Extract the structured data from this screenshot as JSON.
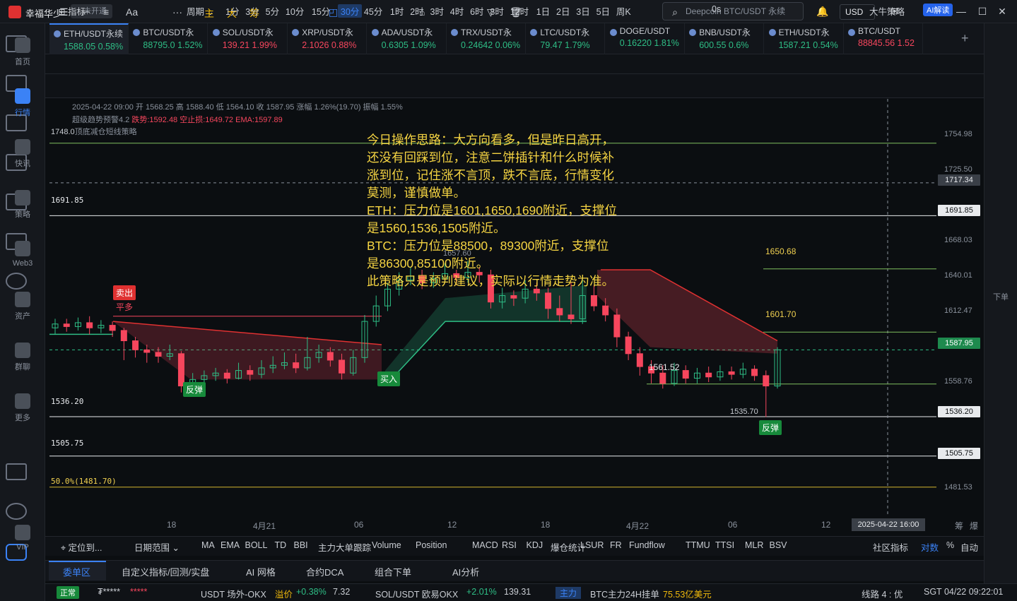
{
  "app": {
    "user": "幸福华少",
    "status": "未开通",
    "search_placeholder": "Deepcoin BTC/USDT 永续",
    "currency": "USD"
  },
  "sidebar": [
    {
      "label": "首页",
      "icon": "home-icon"
    },
    {
      "label": "行情",
      "icon": "chart-icon",
      "active": true
    },
    {
      "label": "快讯",
      "icon": "news-icon"
    },
    {
      "label": "策略",
      "icon": "robot-icon"
    },
    {
      "label": "Web3",
      "icon": "web3-icon"
    },
    {
      "label": "资产",
      "icon": "wallet-icon"
    },
    {
      "label": "群聊",
      "icon": "chat-icon"
    },
    {
      "label": "更多",
      "icon": "grid-icon"
    },
    {
      "label": "VIP",
      "icon": "vip-icon"
    }
  ],
  "right_sidebar": {
    "order_label": "下单"
  },
  "tabs": [
    {
      "name": "ETH/USDT永续",
      "price": "1588.05",
      "change": "0.58%",
      "dir": "up",
      "active": true
    },
    {
      "name": "BTC/USDT永",
      "price": "88795.0",
      "change": "1.52%",
      "dir": "up"
    },
    {
      "name": "SOL/USDT永",
      "price": "139.21",
      "change": "1.99%",
      "dir": "dn"
    },
    {
      "name": "XRP/USDT永",
      "price": "2.1026",
      "change": "0.88%",
      "dir": "dn"
    },
    {
      "name": "ADA/USDT永",
      "price": "0.6305",
      "change": "1.09%",
      "dir": "up"
    },
    {
      "name": "TRX/USDT永",
      "price": "0.24642",
      "change": "0.06%",
      "dir": "up"
    },
    {
      "name": "LTC/USDT永",
      "price": "79.47",
      "change": "1.79%",
      "dir": "up"
    },
    {
      "name": "DOGE/USDT",
      "price": "0.16220",
      "change": "1.81%",
      "dir": "up"
    },
    {
      "name": "BNB/USDT永",
      "price": "600.55",
      "change": "0.6%",
      "dir": "up"
    },
    {
      "name": "ETH/USDT永",
      "price": "1587.21",
      "change": "0.54%",
      "dir": "up"
    },
    {
      "name": "BTC/USDT",
      "price": "88845.56",
      "change": "1.52",
      "dir": "dn"
    }
  ],
  "periods": {
    "indicator": "指标",
    "cycle": "周期",
    "items": [
      "1分",
      "3分",
      "5分",
      "10分",
      "15分",
      "30分",
      "45分",
      "1时",
      "2时",
      "3时",
      "4时",
      "6时",
      "8时",
      "12时",
      "1日",
      "2日",
      "3日",
      "5日",
      "周K"
    ],
    "active": "30分",
    "countdown": "0s",
    "strategy": "大牛策略",
    "ai": "AI解读"
  },
  "draw_tools": [
    "主",
    "大",
    "筹"
  ],
  "info": {
    "line1": "2025-04-22 09:00  开 1568.25  高 1588.40  低 1564.10  收 1587.95  涨幅 1.26%(19.70)  振幅 1.55%",
    "line2a": "超级趋势预警4.2",
    "line2b": "跌势:1592.48  空止损:1649.72  EMA:1597.89",
    "line3a": "1748.0",
    "line3b": "顶底减仓短线策略"
  },
  "levels": {
    "l1": "1691.85",
    "l2": "1536.20",
    "l3": "1505.75",
    "l4": "50.0%(1481.70)"
  },
  "annotations": {
    "a1": "1650.68",
    "a2": "1601.70",
    "a3": "1561.52",
    "a4": "1535.70",
    "a5": "1657.60"
  },
  "signals": {
    "sell": "卖出",
    "close_long": "平多",
    "rebound1": "反弹",
    "buy": "买入",
    "rebound2": "反弹"
  },
  "note": "今日操作思路：大方向看多，但是昨日高开，\n还没有回踩到位，注意二饼插针和什么时候补\n涨到位，记住涨不言顶，跌不言底，行情变化\n莫测，谨慎做单。\nETH：压力位是1601,1650,1690附近，支撑位\n是1560,1536,1505附近。\nBTC：压力位是88500，89300附近，支撑位\n是86300,85100附近。\n此策略只是预判建议，实际以行情走势为准。",
  "price_axis": {
    "ticks": [
      "1754.98",
      "1725.50",
      "1668.03",
      "1640.01",
      "1612.47",
      "1558.76",
      "1481.53"
    ],
    "crosshair": "1717.34",
    "tags": [
      "1691.85",
      "1587.95",
      "1536.20",
      "1505.75"
    ]
  },
  "time_axis": {
    "labels": [
      "18",
      "4月21",
      "06",
      "12",
      "18",
      "4月22",
      "06",
      "12"
    ],
    "crosshair": "2025-04-22 16:00",
    "right": [
      "筹",
      "爆"
    ]
  },
  "indicators": {
    "locate": "定位到...",
    "range": "日期范围",
    "items": [
      "MA",
      "EMA",
      "BOLL",
      "TD",
      "BBI",
      "主力大单跟踪",
      "Volume",
      "Position",
      "MACD",
      "RSI",
      "KDJ",
      "爆仓统计",
      "LSUR",
      "FR",
      "Fundflow",
      "TTMU",
      "TTSI",
      "MLR",
      "BSV"
    ],
    "community": "社区指标",
    "compare": "对数",
    "pct": "%",
    "auto": "自动"
  },
  "bottom_tabs": [
    "委单区",
    "自定义指标/回测/实盘",
    "AI 网格",
    "合约DCA",
    "组合下单",
    "AI分析"
  ],
  "status": {
    "state": "正常",
    "account": "₮*****",
    "stars": "*****",
    "pair1": "USDT 场外-OKX",
    "premium_label": "溢价",
    "premium": "+0.38%",
    "pair1_price": "7.32",
    "pair2": "SOL/USDT 欧易OKX",
    "pair2_change": "+2.01%",
    "pair2_price": "139.31",
    "main_tag": "主力",
    "main_text": "BTC主力24H挂单",
    "main_val": "75.53亿美元",
    "line": "线路 4 : 优",
    "time": "SGT 04/22 09:22:01"
  },
  "chart_data": {
    "type": "candlestick",
    "symbol": "ETH/USDT",
    "interval": "30分",
    "last": 1587.95,
    "high_marked": 1650.68,
    "low_marked": 1535.7,
    "candles": [
      [
        1605,
        1608,
        1612,
        1600
      ],
      [
        1608,
        1606,
        1612,
        1602
      ],
      [
        1606,
        1609,
        1613,
        1603
      ],
      [
        1609,
        1605,
        1614,
        1600
      ],
      [
        1605,
        1607,
        1611,
        1601
      ],
      [
        1607,
        1603,
        1610,
        1598
      ],
      [
        1603,
        1595,
        1605,
        1580
      ],
      [
        1595,
        1588,
        1598,
        1582
      ],
      [
        1588,
        1586,
        1592,
        1578
      ],
      [
        1586,
        1583,
        1590,
        1578
      ],
      [
        1583,
        1585,
        1592,
        1580
      ],
      [
        1585,
        1560,
        1587,
        1555
      ],
      [
        1560,
        1565,
        1570,
        1556
      ],
      [
        1565,
        1568,
        1572,
        1560
      ],
      [
        1568,
        1570,
        1574,
        1564
      ],
      [
        1570,
        1566,
        1573,
        1562
      ],
      [
        1566,
        1572,
        1578,
        1565
      ],
      [
        1572,
        1569,
        1576,
        1564
      ],
      [
        1569,
        1574,
        1580,
        1566
      ],
      [
        1574,
        1576,
        1583,
        1570
      ],
      [
        1576,
        1578,
        1586,
        1573
      ],
      [
        1578,
        1574,
        1585,
        1570
      ],
      [
        1574,
        1582,
        1598,
        1572
      ],
      [
        1582,
        1586,
        1592,
        1578
      ],
      [
        1586,
        1580,
        1590,
        1575
      ],
      [
        1580,
        1570,
        1585,
        1565
      ],
      [
        1570,
        1582,
        1588,
        1568
      ],
      [
        1582,
        1610,
        1615,
        1578
      ],
      [
        1610,
        1622,
        1630,
        1606
      ],
      [
        1622,
        1635,
        1640,
        1618
      ],
      [
        1635,
        1642,
        1648,
        1630
      ],
      [
        1642,
        1645,
        1652,
        1638
      ],
      [
        1645,
        1640,
        1650,
        1635
      ],
      [
        1640,
        1643,
        1648,
        1636
      ],
      [
        1643,
        1647,
        1655,
        1640
      ],
      [
        1647,
        1644,
        1650,
        1638
      ],
      [
        1644,
        1648,
        1657,
        1640
      ],
      [
        1648,
        1646,
        1652,
        1640
      ],
      [
        1646,
        1625,
        1650,
        1620
      ],
      [
        1625,
        1630,
        1636,
        1620
      ],
      [
        1630,
        1628,
        1634,
        1622
      ],
      [
        1628,
        1635,
        1642,
        1624
      ],
      [
        1635,
        1632,
        1640,
        1626
      ],
      [
        1632,
        1620,
        1636,
        1612
      ],
      [
        1620,
        1615,
        1630,
        1610
      ],
      [
        1615,
        1612,
        1640,
        1608
      ],
      [
        1612,
        1630,
        1645,
        1608
      ],
      [
        1630,
        1622,
        1638,
        1618
      ],
      [
        1622,
        1615,
        1628,
        1610
      ],
      [
        1615,
        1598,
        1620,
        1590
      ],
      [
        1598,
        1585,
        1602,
        1580
      ],
      [
        1585,
        1575,
        1590,
        1568
      ],
      [
        1575,
        1570,
        1580,
        1562
      ],
      [
        1570,
        1562,
        1576,
        1558
      ],
      [
        1562,
        1572,
        1578,
        1560
      ],
      [
        1572,
        1566,
        1576,
        1562
      ],
      [
        1566,
        1570,
        1574,
        1562
      ],
      [
        1570,
        1567,
        1575,
        1563
      ],
      [
        1567,
        1571,
        1576,
        1564
      ],
      [
        1571,
        1569,
        1575,
        1565
      ],
      [
        1569,
        1573,
        1578,
        1566
      ],
      [
        1573,
        1568,
        1576,
        1564
      ],
      [
        1568,
        1560,
        1572,
        1536
      ],
      [
        1560,
        1588,
        1590,
        1558
      ]
    ]
  }
}
